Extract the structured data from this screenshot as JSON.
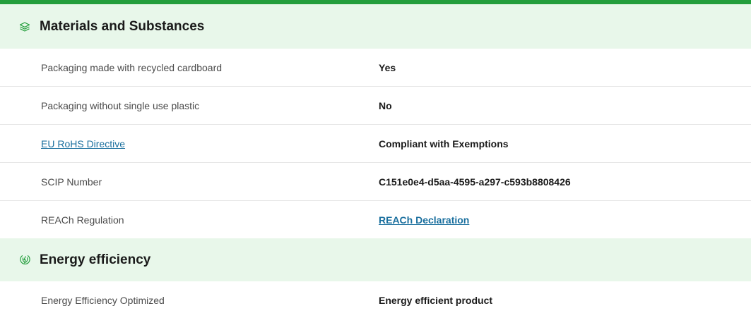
{
  "colors": {
    "accent": "#239e3c",
    "header_bg": "#e8f7ea",
    "link": "#1a6f9e",
    "divider": "#e6e6e6"
  },
  "materials": {
    "title": "Materials and Substances",
    "icon": "layers-icon",
    "rows": [
      {
        "label": "Packaging made with recycled cardboard",
        "value": "Yes"
      },
      {
        "label": "Packaging without single use plastic",
        "value": "No"
      },
      {
        "label": "EU RoHS Directive",
        "value": "Compliant with Exemptions"
      },
      {
        "label": "SCIP Number",
        "value": "C151e0e4-d5aa-4595-a297-c593b8808426"
      },
      {
        "label": "REACh Regulation",
        "value": "REACh Declaration"
      }
    ]
  },
  "energy": {
    "title": "Energy efficiency",
    "icon": "leaf-energy-icon",
    "rows": [
      {
        "label": "Energy Efficiency Optimized",
        "value": "Energy efficient product"
      }
    ]
  }
}
